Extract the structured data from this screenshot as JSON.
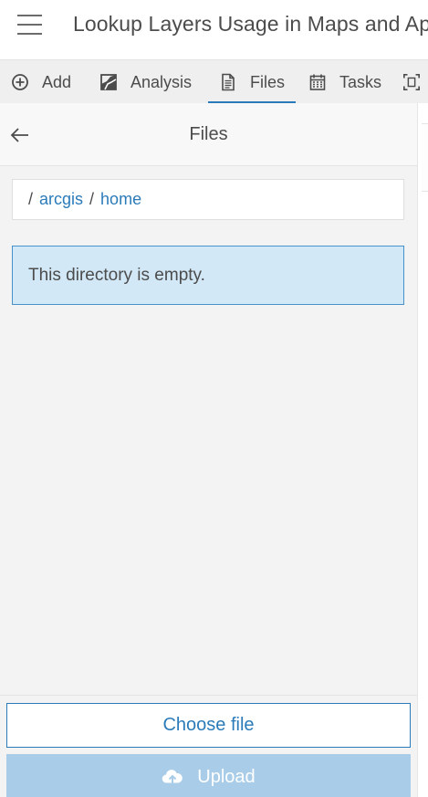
{
  "header": {
    "title": "Lookup Layers Usage in Maps and Apps",
    "menu_icon": "hamburger-menu-icon"
  },
  "toolbar": {
    "items": [
      {
        "label": "Add",
        "icon": "plus-circle-icon"
      },
      {
        "label": "Analysis",
        "icon": "analysis-icon"
      },
      {
        "label": "Files",
        "icon": "file-icon",
        "active": true
      },
      {
        "label": "Tasks",
        "icon": "calendar-icon"
      },
      {
        "label": "",
        "icon": "expand-icon"
      }
    ]
  },
  "panel": {
    "title": "Files",
    "back_icon": "arrow-left-icon",
    "breadcrumb": {
      "separator": "/",
      "parts": [
        "arcgis",
        "home"
      ]
    },
    "empty_message": "This directory is empty.",
    "choose_file_label": "Choose file",
    "upload_label": "Upload",
    "upload_icon": "cloud-upload-icon"
  },
  "colors": {
    "accent": "#2b7bb9",
    "notice_bg": "#d2e8f7",
    "notice_border": "#4792c9",
    "upload_disabled_bg": "#a9cde8",
    "panel_bg": "#f3f3f3",
    "toolbar_bg": "#efefef",
    "text": "#4c4c4c"
  }
}
